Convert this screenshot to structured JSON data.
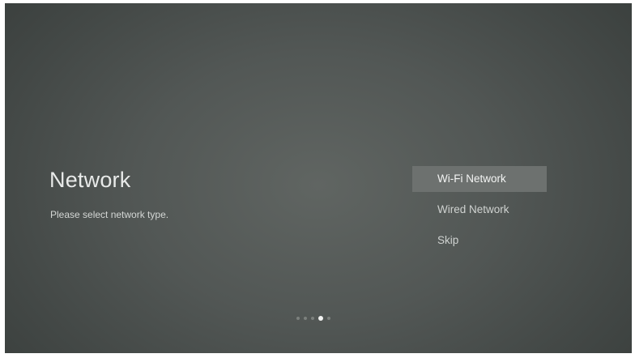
{
  "page": {
    "title": "Network",
    "subtitle": "Please select network type."
  },
  "menu": {
    "items": [
      {
        "label": "Wi-Fi Network",
        "selected": true
      },
      {
        "label": "Wired Network",
        "selected": false
      },
      {
        "label": "Skip",
        "selected": false
      }
    ]
  },
  "pager": {
    "total": 5,
    "current": 4
  },
  "colors": {
    "background": "#525755",
    "selected_highlight": "#6d716f",
    "text": "#e8eae9"
  }
}
